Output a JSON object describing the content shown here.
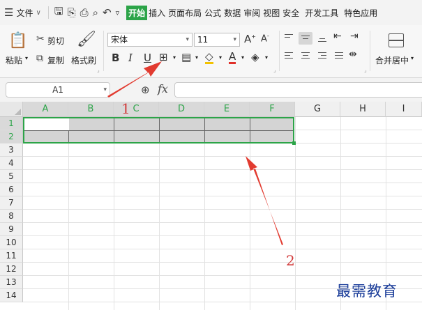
{
  "menubar": {
    "file_label": "文件",
    "tabs": [
      "开始",
      "插入",
      "页面布局",
      "公式",
      "数据",
      "审阅",
      "视图",
      "安全",
      "开发工具",
      "特色应用"
    ]
  },
  "ribbon": {
    "paste": "粘贴",
    "cut": "剪切",
    "copy": "复制",
    "format_painter": "格式刷",
    "font_name": "宋体",
    "font_size": "11",
    "bold": "B",
    "italic": "I",
    "underline": "U",
    "font_color": "A",
    "merge_center": "合并居中"
  },
  "formula_bar": {
    "name_box": "A1",
    "fx": "fx"
  },
  "grid": {
    "columns": [
      "A",
      "B",
      "C",
      "D",
      "E",
      "F",
      "G",
      "H",
      "I"
    ],
    "rows": [
      "1",
      "2",
      "3",
      "4",
      "5",
      "6",
      "7",
      "8",
      "9",
      "10",
      "11",
      "12",
      "13",
      "14"
    ],
    "selected_columns": [
      "A",
      "B",
      "C",
      "D",
      "E",
      "F"
    ],
    "selected_rows": [
      "1",
      "2"
    ]
  },
  "annotations": {
    "label1": "1",
    "label2": "2",
    "arrow_color": "#e23b30"
  },
  "watermark": "最需教育",
  "colors": {
    "accent": "#2ca448",
    "watermark": "#1c3e9a"
  }
}
